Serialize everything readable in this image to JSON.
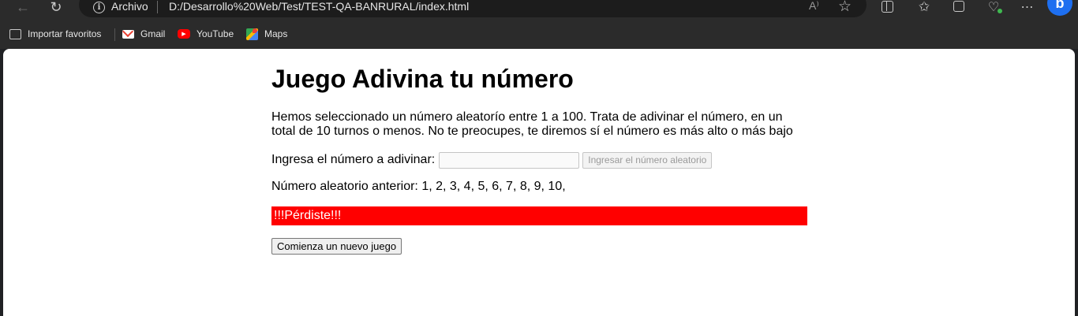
{
  "browser": {
    "address_scheme": "Archivo",
    "address_url": "D:/Desarrollo%20Web/Test/TEST-QA-BANRURAL/index.html",
    "read_aloud_glyph": "A⁾",
    "icons": {
      "back": "back-arrow-icon",
      "reload": "reload-icon",
      "info": "info-icon",
      "favorite": "star-icon",
      "split": "split-screen-icon",
      "favorites": "favorites-icon",
      "collections": "collections-icon",
      "health": "browser-essentials-icon",
      "more": "more-icon",
      "copilot": "copilot-icon"
    },
    "bookmarks": [
      {
        "label": "Importar favoritos",
        "icon": "import-icon"
      },
      {
        "label": "Gmail",
        "icon": "gmail-icon",
        "color": "#ea4335"
      },
      {
        "label": "YouTube",
        "icon": "youtube-icon",
        "color": "#ff0000"
      },
      {
        "label": "Maps",
        "icon": "maps-icon"
      }
    ]
  },
  "page": {
    "title": "Juego Adivina tu número",
    "intro": "Hemos seleccionado un número aleatorío entre 1 a 100. Trata de adivinar el número, en un total de 10 turnos o menos. No te preocupes, te diremos sí el número es más alto o más bajo",
    "guess_label": "Ingresa el número a adivinar:",
    "guess_value": "",
    "submit_label": "Ingresar el número aleatorio",
    "previous_guesses": "Número aleatorio anterior: 1, 2, 3, 4, 5, 6, 7, 8, 9, 10,",
    "result_text": "!!!Pérdiste!!!",
    "result_color": "#ff0000",
    "new_game_label": "Comienza un nuevo juego"
  }
}
